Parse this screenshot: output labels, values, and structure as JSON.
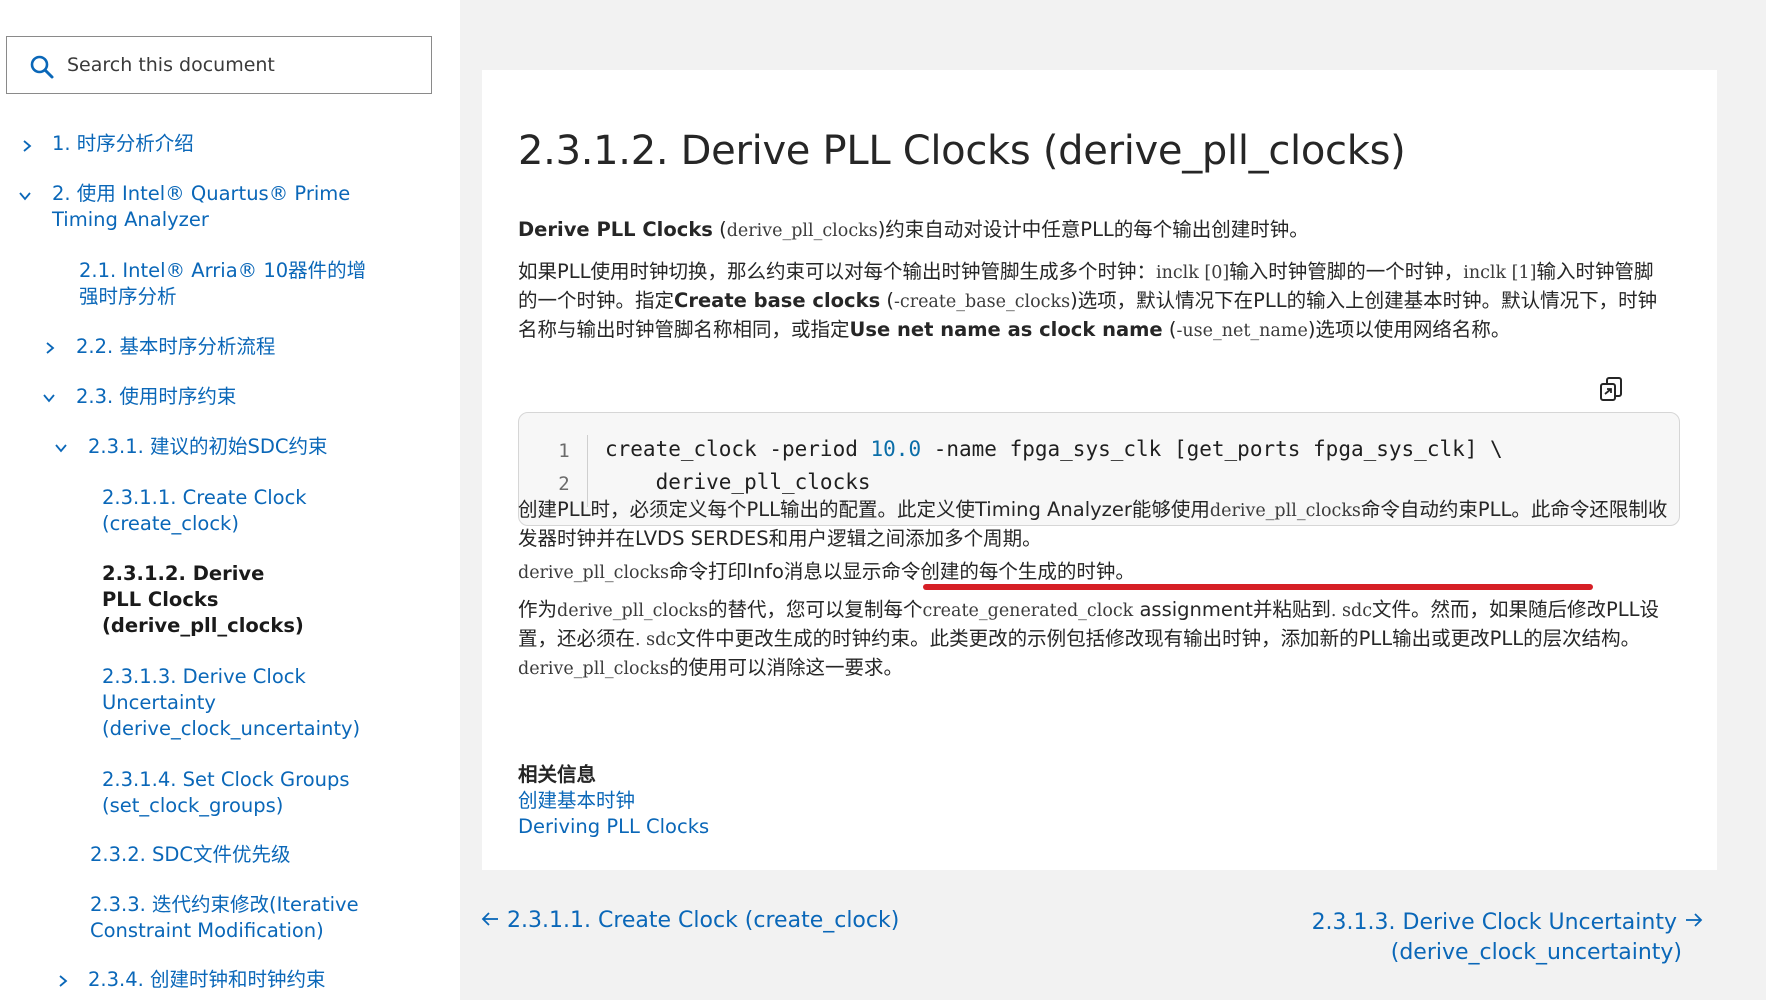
{
  "search": {
    "placeholder": "Search this document"
  },
  "sidebar": {
    "items": [
      {
        "label": "1. 时序分析介绍"
      },
      {
        "label": "2. 使用 Intel® Quartus® Prime Timing Analyzer"
      },
      {
        "label": "2.1. Intel® Arria® 10器件的增强时序分析"
      },
      {
        "label": "2.2. 基本时序分析流程"
      },
      {
        "label": "2.3. 使用时序约束"
      },
      {
        "label": "2.3.1. 建议的初始SDC约束"
      },
      {
        "label": "2.3.1.1. Create Clock (create_clock)"
      },
      {
        "label": "2.3.1.2. Derive PLL Clocks (derive_pll_clocks)"
      },
      {
        "label": "2.3.1.3. Derive Clock Uncertainty (derive_clock_uncertainty)"
      },
      {
        "label": "2.3.1.4. Set Clock Groups (set_clock_groups)"
      },
      {
        "label": "2.3.2. SDC文件优先级"
      },
      {
        "label": "2.3.3. 迭代约束修改(Iterative Constraint Modification)"
      },
      {
        "label": "2.3.4. 创建时钟和时钟约束"
      }
    ]
  },
  "main": {
    "title": "2.3.1.2. Derive PLL Clocks (derive_pll_clocks)",
    "p1": {
      "bold": "Derive PLL Clocks",
      "t1": " (",
      "code": "derive_pll_clocks",
      "t2": ")约束自动对设计中任意PLL的每个输出创建时钟。"
    },
    "p2": {
      "t1": "如果PLL使用时钟切换，那么约束可以对每个输出时钟管脚生成多个时钟：",
      "c1": "inclk [0]",
      "t2": "输入时钟管脚的一个时钟，",
      "c2": "inclk [1]",
      "t3": "输入时钟管脚的一个时钟。指定",
      "b1": "Create base clocks",
      "t4": " (",
      "c3": "-create_base_clocks",
      "t5": ")选项，默认情况下在PLL的输入上创建基本时钟。默认情况下，时钟名称与输出时钟管脚名称相同，或指定",
      "b2": "Use net name as clock name",
      "t6": " (",
      "c4": "-use_net_name",
      "t7": ")选项以使用网络名称。"
    },
    "code": {
      "line_numbers": [
        "1",
        "2"
      ],
      "line1_a": "create_clock -period ",
      "line1_num": "10.0",
      "line1_b": " -name fpga_sys_clk [get_ports fpga_sys_clk] \\",
      "line2": "    derive_pll_clocks"
    },
    "p3": {
      "t1": "创建PLL时，必须定义每个PLL输出的配置。此定义使Timing Analyzer能够使用",
      "code": "derive_pll_clocks",
      "t2": "命令自动约束PLL。此命令还限制收发器时钟并在LVDS SERDES和用户逻辑之间添加多个周期。"
    },
    "p4": {
      "code": "derive_pll_clocks",
      "t1": "命令打印Info消息以显示命令创建的每个生成的时钟。"
    },
    "p5": {
      "t1": "作为",
      "c1": "derive_pll_clocks",
      "t2": "的替代，您可以复制每个",
      "c2": "create_generated_clock",
      "t3": " assignment并粘贴到",
      "c3": ". sdc",
      "t4": "文件。然而，如果随后修改PLL设置，还必须在",
      "c4": ". sdc",
      "t5": "文件中更改生成的时钟约束。此类更改的示例包括修改现有输出时钟，添加新的PLL输出或更改PLL的层次结构。",
      "c5": "derive_pll_clocks",
      "t6": "的使用可以消除这一要求。"
    },
    "related": {
      "heading": "相关信息",
      "links": [
        "创建基本时钟",
        "Deriving PLL Clocks"
      ]
    }
  },
  "nav": {
    "prev": "2.3.1.1. Create Clock (create_clock)",
    "next_line1": "2.3.1.3. Derive Clock Uncertainty",
    "next_line2": "(derive_clock_uncertainty)"
  },
  "colors": {
    "link": "#0a67b8",
    "underline": "#d61f26",
    "code_bg": "#f7f7f7"
  }
}
